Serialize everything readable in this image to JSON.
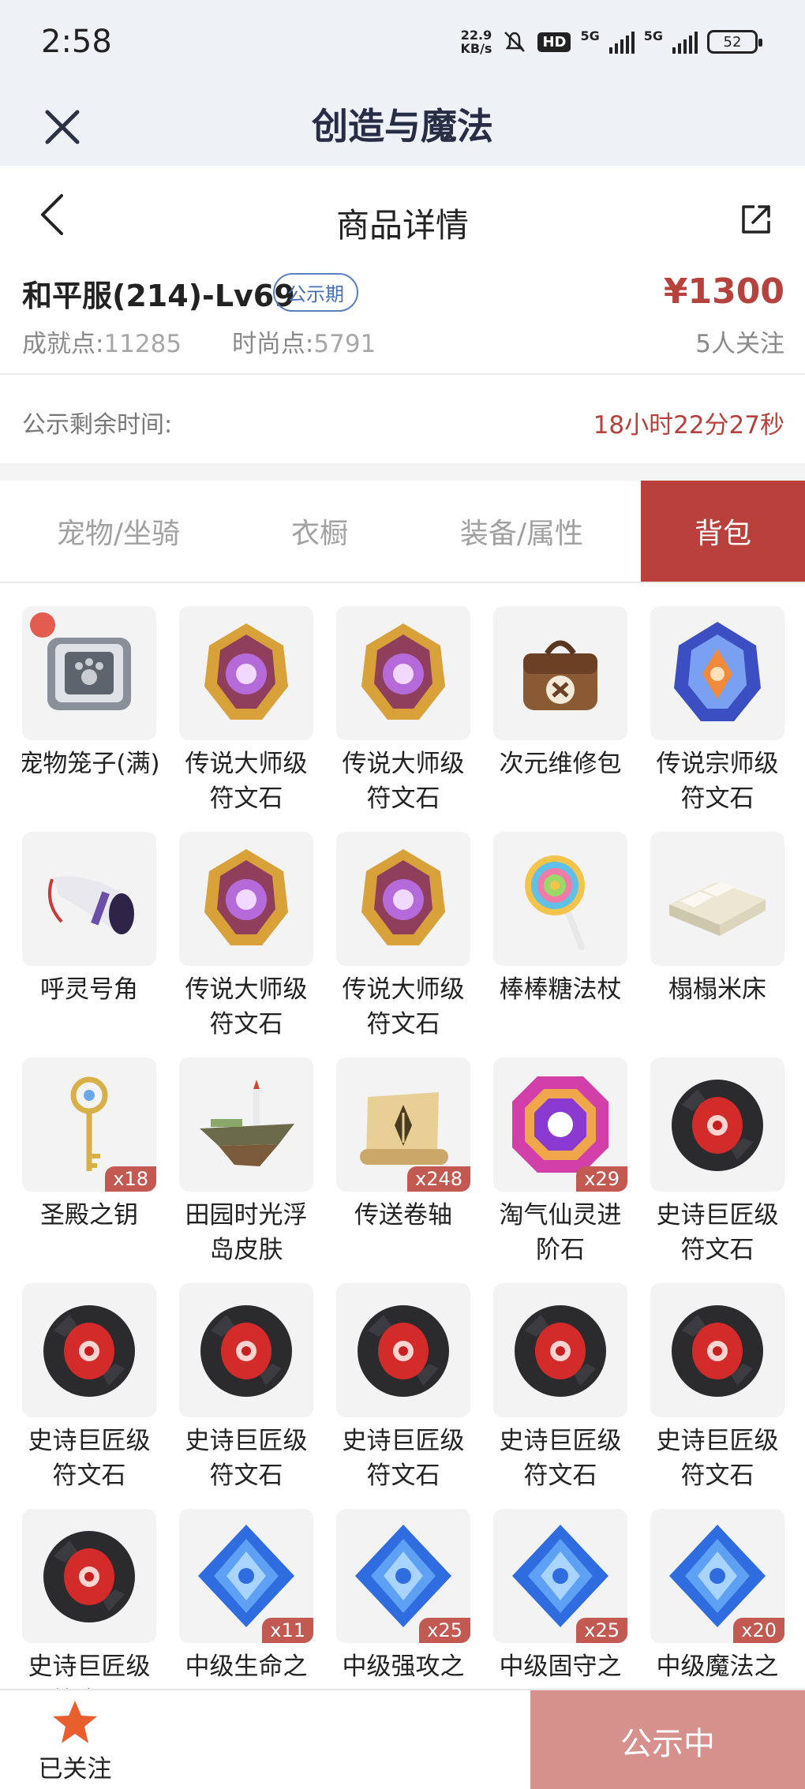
{
  "status_bar": {
    "time": "2:58",
    "net_speed_value": "22.9",
    "net_speed_unit": "KB/s",
    "hd_label": "HD",
    "signal1_label": "5G",
    "signal2_label": "5G",
    "battery": "52",
    "icons": [
      "mute-bell-icon",
      "hd-icon",
      "signal-icon",
      "signal-icon",
      "battery-icon"
    ]
  },
  "app_header": {
    "title": "创造与魔法",
    "close_icon": "close-icon"
  },
  "page_header": {
    "title": "商品详情",
    "back_icon": "chevron-left-icon",
    "share_icon": "share-icon"
  },
  "product": {
    "name": "和平服(214)-Lv69",
    "badge": "公示期",
    "price": "¥1300",
    "stat1_label": "成就点:",
    "stat1_value": "11285",
    "stat2_label": "时尚点:",
    "stat2_value": "5791",
    "followers": "5人关注"
  },
  "countdown": {
    "label": "公示剩余时间:",
    "value": "18小时22分27秒"
  },
  "tabs": [
    {
      "label": "宠物/坐骑",
      "active": false
    },
    {
      "label": "衣橱",
      "active": false
    },
    {
      "label": "装备/属性",
      "active": false
    },
    {
      "label": "背包",
      "active": true
    }
  ],
  "items": [
    {
      "name": "宠物笼子(满)",
      "icon": "pet-cage-icon",
      "qty": ""
    },
    {
      "name": "传说大师级符文石",
      "icon": "gold-rune-icon",
      "qty": ""
    },
    {
      "name": "传说大师级符文石",
      "icon": "gold-rune-icon",
      "qty": ""
    },
    {
      "name": "次元维修包",
      "icon": "repair-bag-icon",
      "qty": ""
    },
    {
      "name": "传说宗师级符文石",
      "icon": "blue-rune-icon",
      "qty": ""
    },
    {
      "name": "呼灵号角",
      "icon": "horn-icon",
      "qty": ""
    },
    {
      "name": "传说大师级符文石",
      "icon": "gold-rune-icon",
      "qty": ""
    },
    {
      "name": "传说大师级符文石",
      "icon": "gold-rune-icon",
      "qty": ""
    },
    {
      "name": "棒棒糖法杖",
      "icon": "lollipop-icon",
      "qty": ""
    },
    {
      "name": "榻榻米床",
      "icon": "bed-icon",
      "qty": ""
    },
    {
      "name": "圣殿之钥",
      "icon": "key-icon",
      "qty": "x18"
    },
    {
      "name": "田园时光浮岛皮肤",
      "icon": "island-icon",
      "qty": ""
    },
    {
      "name": "传送卷轴",
      "icon": "scroll-icon",
      "qty": "x248"
    },
    {
      "name": "淘气仙灵进阶石",
      "icon": "fairy-stone-icon",
      "qty": "x29"
    },
    {
      "name": "史诗巨匠级符文石",
      "icon": "red-rune-icon",
      "qty": ""
    },
    {
      "name": "史诗巨匠级符文石",
      "icon": "red-rune-icon",
      "qty": ""
    },
    {
      "name": "史诗巨匠级符文石",
      "icon": "red-rune-icon",
      "qty": ""
    },
    {
      "name": "史诗巨匠级符文石",
      "icon": "red-rune-icon",
      "qty": ""
    },
    {
      "name": "史诗巨匠级符文石",
      "icon": "red-rune-icon",
      "qty": ""
    },
    {
      "name": "史诗巨匠级符文石",
      "icon": "red-rune-icon",
      "qty": ""
    },
    {
      "name": "史诗巨匠级符文石",
      "icon": "red-rune-icon",
      "qty": ""
    },
    {
      "name": "中级生命之晶",
      "icon": "blue-crystal-icon",
      "qty": "x11"
    },
    {
      "name": "中级强攻之晶",
      "icon": "blue-crystal-icon",
      "qty": "x25"
    },
    {
      "name": "中级固守之晶",
      "icon": "blue-crystal-icon",
      "qty": "x25"
    },
    {
      "name": "中级魔法之晶",
      "icon": "blue-crystal-icon",
      "qty": "x20"
    }
  ],
  "bottom_bar": {
    "follow_label": "已关注",
    "follow_icon": "star-icon",
    "status_button": "公示中"
  },
  "colors": {
    "accent": "#b9403b",
    "price": "#b5423c",
    "status_button": "#d6918c",
    "badge_border": "#5a7ec4",
    "qty_badge": "#c35a52"
  }
}
